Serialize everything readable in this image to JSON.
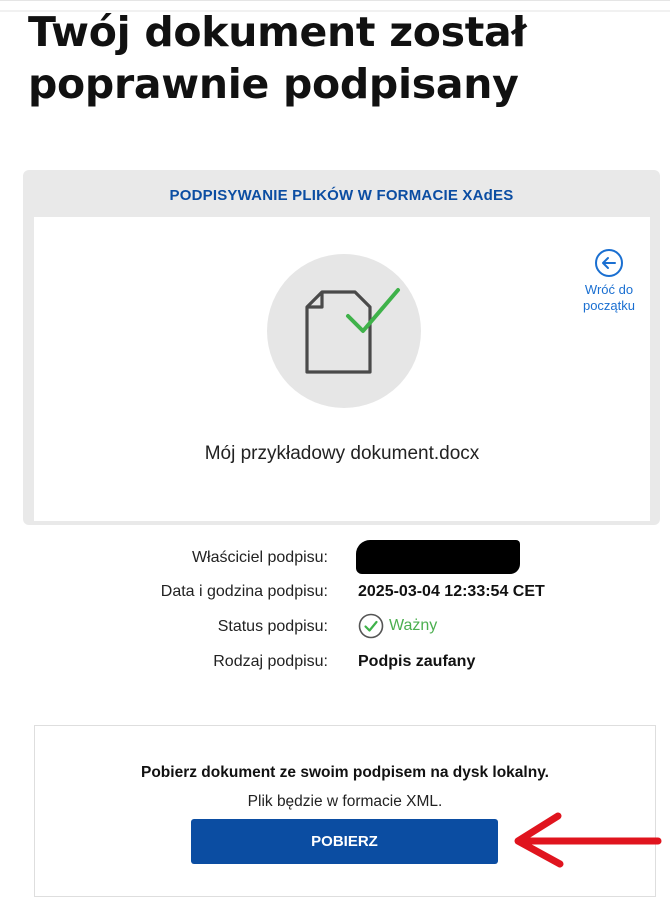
{
  "page": {
    "title": "Twój dokument został poprawnie podpisany"
  },
  "signing_panel": {
    "header": "PODPISYWANIE PLIKÓW W FORMACIE XAdES",
    "file_name": "Mój przykładowy dokument.docx",
    "document_icon": "signed-document-icon",
    "back_link": {
      "label": "Wróć do początku",
      "icon": "arrow-left-circle-icon"
    }
  },
  "signature_info": {
    "owner_label": "Właściciel podpisu:",
    "owner_value_redacted": true,
    "date_label": "Data i godzina podpisu:",
    "date_value": "2025-03-04 12:33:54 CET",
    "status_label": "Status podpisu:",
    "status_value": "Ważny",
    "status_icon": "check-circle-icon",
    "type_label": "Rodzaj podpisu:",
    "type_value": "Podpis zaufany"
  },
  "download": {
    "heading": "Pobierz dokument ze swoim podpisem na dysk lokalny.",
    "subtext": "Plik będzie w formacie XML.",
    "button_label": "POBIERZ"
  },
  "annotation": {
    "icon": "red-arrow-icon"
  },
  "colors": {
    "brand_blue": "#0b4da2",
    "link_blue": "#1a6fd1",
    "success_green": "#4caf50",
    "annotation_red": "#e0141e"
  }
}
